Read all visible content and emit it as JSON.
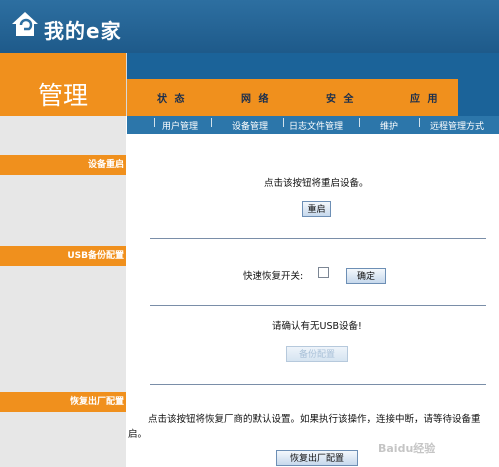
{
  "app": {
    "title": "我的e家"
  },
  "left_panel": {
    "title": "管理"
  },
  "main_tabs": [
    {
      "label": "状 态"
    },
    {
      "label": "网 络"
    },
    {
      "label": "安 全"
    },
    {
      "label": "应 用"
    }
  ],
  "sub_tabs": [
    {
      "label": "用户管理"
    },
    {
      "label": "设备管理"
    },
    {
      "label": "日志文件管理"
    },
    {
      "label": "维护"
    },
    {
      "label": "远程管理方式"
    }
  ],
  "sections": {
    "restart": {
      "label": "设备重启",
      "description": "点击该按钮将重启设备。",
      "button_label": "重启"
    },
    "usb_backup": {
      "label": "USB备份配置",
      "quick_restore_label": "快速恢复开关:",
      "confirm_button_label": "确定",
      "usb_prompt": "请确认有无USB设备!",
      "disabled_button_label": "备份配置"
    },
    "factory_reset": {
      "label": "恢复出厂配置",
      "description_line1": "点击该按钮将恢复厂商的默认设置。如果执行该操作，连接中断，请等待设备重",
      "description_line2": "启。",
      "button_label": "恢复出厂配置"
    }
  },
  "watermark": {
    "text": "Baidu经验"
  },
  "colors": {
    "orange": "#f0901d",
    "blue": "#1b6399",
    "light_gray": "#e7e7e7"
  }
}
